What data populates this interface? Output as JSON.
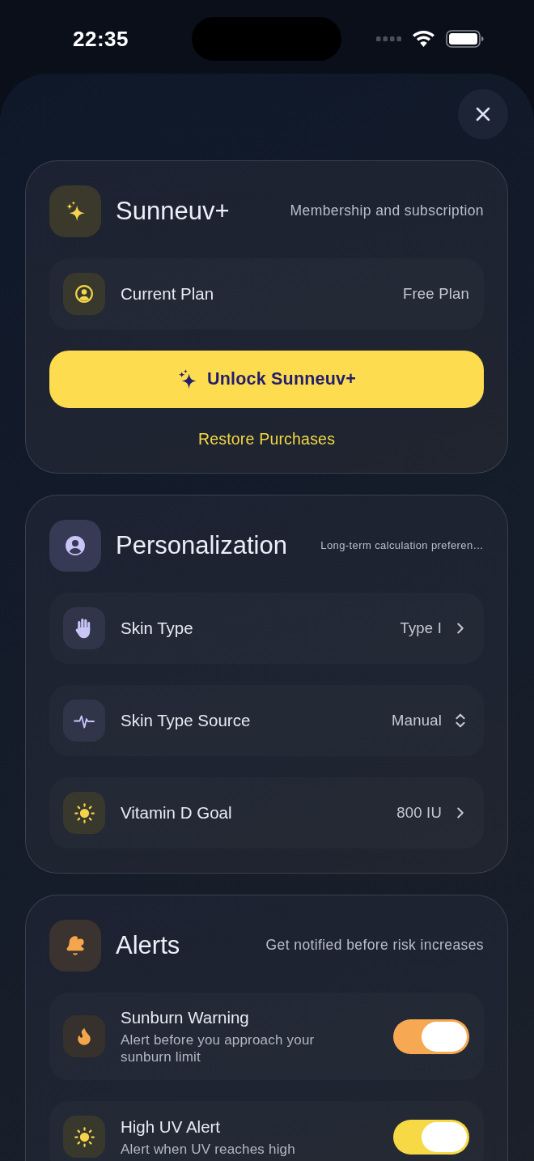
{
  "status_bar": {
    "time": "22:35"
  },
  "sections": [
    {
      "title": "Sunneuv+",
      "subtitle": "Membership and subscription",
      "rows": [
        {
          "kind": "value",
          "label": "Current Plan",
          "value": "Free Plan"
        }
      ],
      "primary_button": {
        "label": "Unlock Sunneuv+"
      },
      "link": {
        "label": "Restore Purchases"
      }
    },
    {
      "title": "Personalization",
      "subtitle": "Long-term calculation preferen…",
      "rows": [
        {
          "kind": "link",
          "label": "Skin Type",
          "value": "Type I"
        },
        {
          "kind": "picker",
          "label": "Skin Type Source",
          "value": "Manual"
        },
        {
          "kind": "link",
          "label": "Vitamin D Goal",
          "value": "800 IU"
        }
      ]
    },
    {
      "title": "Alerts",
      "subtitle": "Get notified before risk increases",
      "rows": [
        {
          "kind": "toggle",
          "label": "Sunburn Warning",
          "description": "Alert before you approach your sunburn limit",
          "on": true
        },
        {
          "kind": "toggle",
          "label": "High UV Alert",
          "description": "Alert when UV reaches high",
          "on": true
        }
      ]
    }
  ]
}
